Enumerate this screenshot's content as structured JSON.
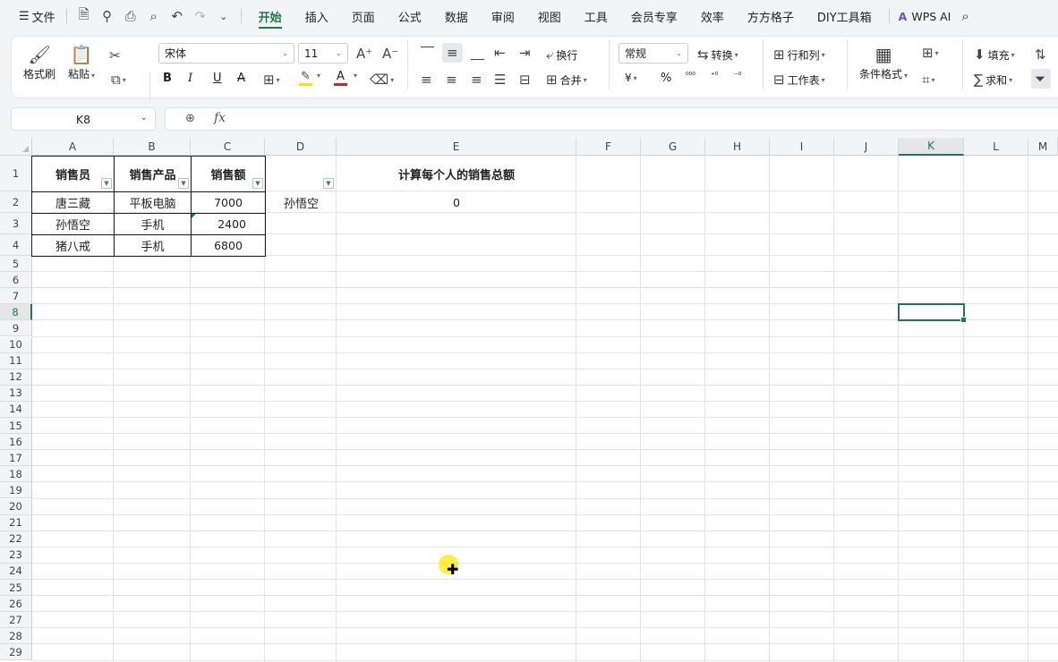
{
  "menubar": {
    "menu_icon": "hamburger-icon",
    "file_label": "文件",
    "quick_icons": [
      "save-icon",
      "link-icon",
      "print-icon",
      "print-preview-icon",
      "undo-icon",
      "redo-icon",
      "more-chevron-icon"
    ],
    "tabs": [
      "开始",
      "插入",
      "页面",
      "公式",
      "数据",
      "审阅",
      "视图",
      "工具",
      "会员专享",
      "效率",
      "方方格子",
      "DIY工具箱"
    ],
    "active_tab": "开始",
    "ai_label": "WPS AI",
    "search_icon": "search-icon"
  },
  "ribbon": {
    "format_painter": "格式刷",
    "paste": "粘贴",
    "font_name": "宋体",
    "font_size": "11",
    "wrap": "换行",
    "merge": "合并",
    "number_format": "常规",
    "convert": "转换",
    "row_col": "行和列",
    "worksheet": "工作表",
    "cond_format": "条件格式",
    "fill": "填充",
    "sum": "求和",
    "bold": "B",
    "italic": "I",
    "underline": "U",
    "currency": "¥",
    "percent": "%",
    "font_color": "#e02020",
    "highlight_color": "#f5e600"
  },
  "formula_bar": {
    "name_box": "K8",
    "fx_label": "fx",
    "formula": ""
  },
  "sheet": {
    "columns": [
      "A",
      "B",
      "C",
      "D",
      "E",
      "F",
      "G",
      "H",
      "I",
      "J",
      "K",
      "L",
      "M"
    ],
    "selected_column": "K",
    "rows": [
      "1",
      "2",
      "3",
      "4",
      "5",
      "6",
      "7",
      "8",
      "9",
      "10",
      "11",
      "12",
      "13",
      "14",
      "15",
      "16",
      "17",
      "18",
      "19",
      "20",
      "21",
      "22",
      "23",
      "24",
      "25",
      "26",
      "27",
      "28",
      "29"
    ],
    "selected_row": "8",
    "headers": {
      "a": "销售员",
      "b": "销售产品",
      "c": "销售额"
    },
    "data": [
      {
        "a": "唐三藏",
        "b": "平板电脑",
        "c": "7000"
      },
      {
        "a": "孙悟空",
        "b": "手机",
        "c": "2400"
      },
      {
        "a": "猪八戒",
        "b": "手机",
        "c": "6800"
      }
    ],
    "e1_title": "计算每个人的销售总额",
    "d2": "孙悟空",
    "e2": "0",
    "selected_cell": "K8"
  }
}
